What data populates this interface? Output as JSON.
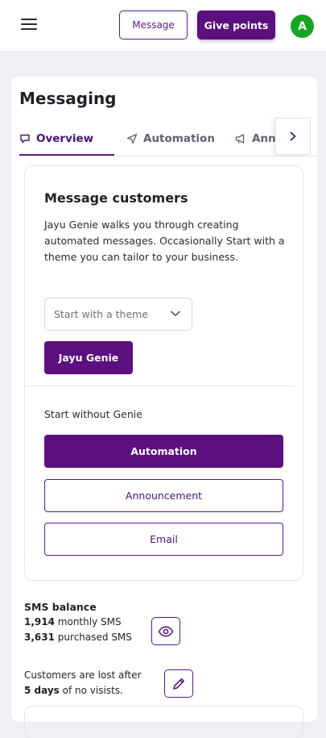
{
  "header": {
    "message_label": "Message",
    "give_points_label": "Give points",
    "avatar_initial": "A"
  },
  "page": {
    "title": "Messaging"
  },
  "tabs": [
    {
      "label": "Overview",
      "icon": "chat-bubble-icon",
      "active": true
    },
    {
      "label": "Automation",
      "icon": "paper-plane-icon",
      "active": false
    },
    {
      "label": "Anno",
      "icon": "megaphone-icon",
      "active": false
    }
  ],
  "panel": {
    "title": "Message customers",
    "description": "Jayu Genie walks you through creating automated messages. Occasionally Start with a theme you can tailor to your business.",
    "theme_select_placeholder": "Start with a theme",
    "genie_button_label": "Jayu Genie",
    "start_without_label": "Start without Genie",
    "automation_button_label": "Automation",
    "announcement_button_label": "Announcement",
    "email_button_label": "Email"
  },
  "sms": {
    "title": "SMS balance",
    "monthly_count": "1,914",
    "monthly_label": "monthly SMS",
    "purchased_count": "3,631",
    "purchased_label": "purchased SMS"
  },
  "lost": {
    "line1": "Customers are lost after",
    "days": "5 days",
    "line2_suffix": "of no visists."
  },
  "colors": {
    "brand": "#5c0f7f",
    "avatar": "#15a521",
    "page_bg": "#eef0f6"
  }
}
